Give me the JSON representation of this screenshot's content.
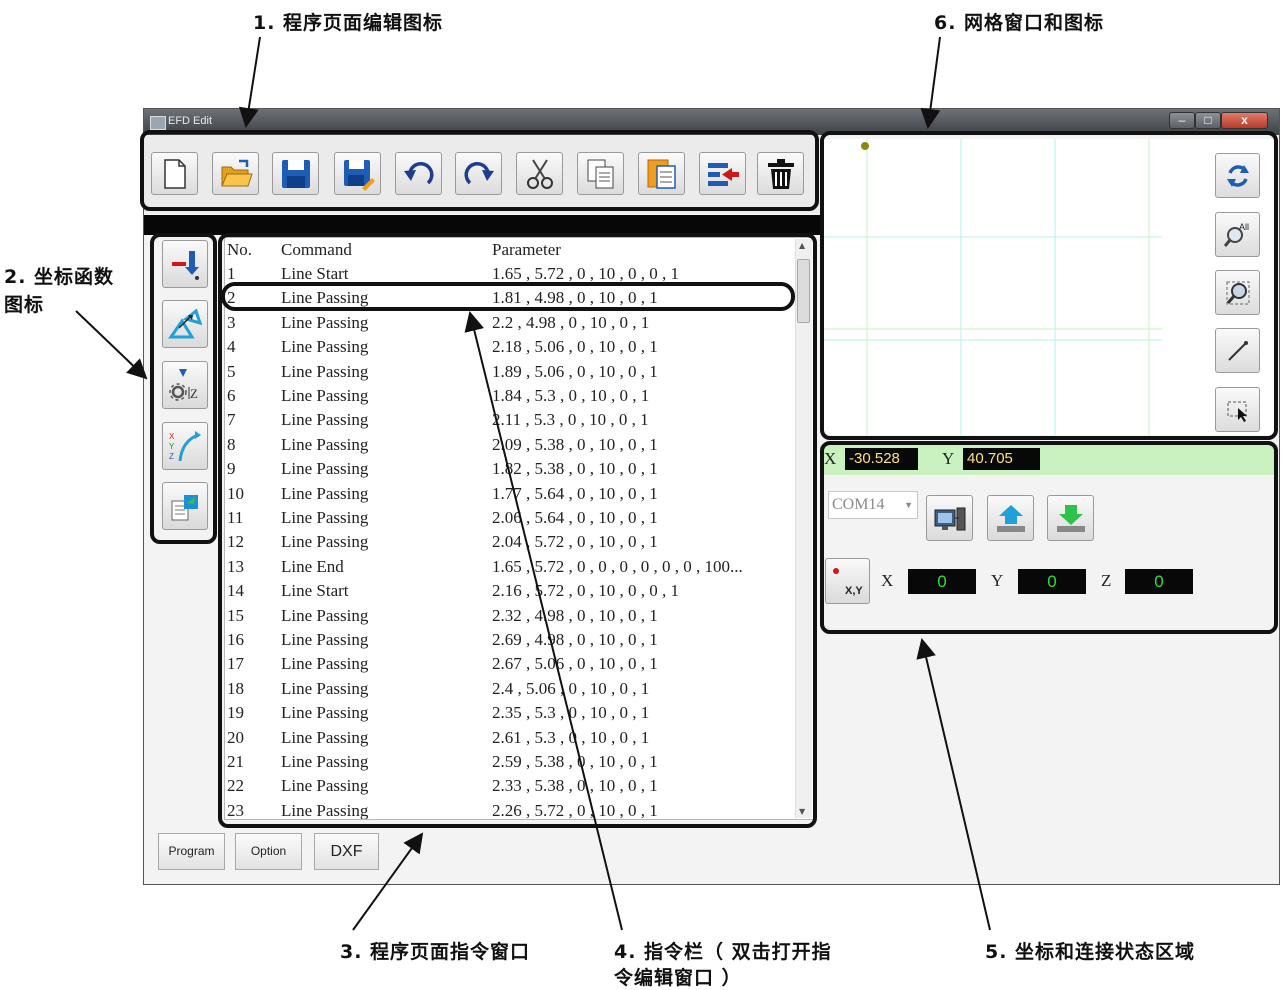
{
  "annotations": {
    "toolbar": "1. 程序页面编辑图标",
    "coordinate_functions_line1": "2. 坐标函数",
    "coordinate_functions_line2": "图标",
    "command_window": "3. 程序页面指令窗口",
    "command_row_line1": "4. 指令栏（ 双击打开指",
    "command_row_line2": "令编辑窗口 ）",
    "status_area": "5. 坐标和连接状态区域",
    "grid_window": "6. 网格窗口和图标"
  },
  "window": {
    "title": "EFD Edit",
    "minimize_glyph": "–",
    "maximize_glyph": "□",
    "close_glyph": "x"
  },
  "command_table": {
    "columns": [
      "No.",
      "Command",
      "Parameter"
    ],
    "rows": [
      [
        "1",
        "Line Start",
        "1.65 , 5.72 , 0 , 10 , 0 , 0 , 1"
      ],
      [
        "2",
        "Line Passing",
        "1.81 , 4.98 , 0 , 10 , 0 , 1"
      ],
      [
        "3",
        "Line Passing",
        "2.2 , 4.98 , 0 , 10 , 0 , 1"
      ],
      [
        "4",
        "Line Passing",
        "2.18 , 5.06 , 0 , 10 , 0 , 1"
      ],
      [
        "5",
        "Line Passing",
        "1.89 , 5.06 , 0 , 10 , 0 , 1"
      ],
      [
        "6",
        "Line Passing",
        "1.84 , 5.3 , 0 , 10 , 0 , 1"
      ],
      [
        "7",
        "Line Passing",
        "2.11 , 5.3 , 0 , 10 , 0 , 1"
      ],
      [
        "8",
        "Line Passing",
        "2.09 , 5.38 , 0 , 10 , 0 , 1"
      ],
      [
        "9",
        "Line Passing",
        "1.82 , 5.38 , 0 , 10 , 0 , 1"
      ],
      [
        "10",
        "Line Passing",
        "1.77 , 5.64 , 0 , 10 , 0 , 1"
      ],
      [
        "11",
        "Line Passing",
        "2.06 , 5.64 , 0 , 10 , 0 , 1"
      ],
      [
        "12",
        "Line Passing",
        "2.04 , 5.72 , 0 , 10 , 0 , 1"
      ],
      [
        "13",
        "Line End",
        "1.65 , 5.72 , 0 , 0 , 0 , 0 , 0 , 0 , 100..."
      ],
      [
        "14",
        "Line Start",
        "2.16 , 5.72 , 0 , 10 , 0 , 0 , 1"
      ],
      [
        "15",
        "Line Passing",
        "2.32 , 4.98 , 0 , 10 , 0 , 1"
      ],
      [
        "16",
        "Line Passing",
        "2.69 , 4.98 , 0 , 10 , 0 , 1"
      ],
      [
        "17",
        "Line Passing",
        "2.67 , 5.06 , 0 , 10 , 0 , 1"
      ],
      [
        "18",
        "Line Passing",
        "2.4 , 5.06 , 0 , 10 , 0 , 1"
      ],
      [
        "19",
        "Line Passing",
        "2.35 , 5.3 , 0 , 10 , 0 , 1"
      ],
      [
        "20",
        "Line Passing",
        "2.61 , 5.3 , 0 , 10 , 0 , 1"
      ],
      [
        "21",
        "Line Passing",
        "2.59 , 5.38 , 0 , 10 , 0 , 1"
      ],
      [
        "22",
        "Line Passing",
        "2.33 , 5.38 , 0 , 10 , 0 , 1"
      ],
      [
        "23",
        "Line Passing",
        "2.26 , 5.72 , 0 , 10 , 0 , 1"
      ]
    ]
  },
  "bottom_tabs": [
    "Program",
    "Option",
    "DXF"
  ],
  "status": {
    "x_label": "X",
    "x_value": "-30.528",
    "y_label": "Y",
    "y_value": "40.705",
    "com_port": "COM14",
    "pos_x_label": "X",
    "pos_x_value": "0",
    "pos_y_label": "Y",
    "pos_y_value": "0",
    "pos_z_label": "Z",
    "pos_z_value": "0",
    "xy_button_label": "X,Y"
  },
  "grid": {
    "zoom_all_text": "All"
  },
  "toolbar_icons": [
    "new-file-icon",
    "open-folder-icon",
    "save-icon",
    "save-as-icon",
    "undo-icon",
    "redo-icon",
    "cut-icon",
    "copy-icon",
    "paste-icon",
    "insert-icon",
    "delete-icon"
  ],
  "sidebar_icons": [
    "move-point-icon",
    "offset-icon",
    "z-height-icon",
    "xyz-axis-icon",
    "import-icon"
  ],
  "grid_icons": [
    "refresh-icon",
    "zoom-all-icon",
    "zoom-window-icon",
    "line-tool-icon",
    "select-area-icon"
  ],
  "colors": {
    "accent_blue": "#1f5db5",
    "status_green": "#c9f2c0",
    "readout_yellow": "#ffe27a",
    "readout_green": "#2ee02e",
    "close_red": "#c94a38"
  }
}
